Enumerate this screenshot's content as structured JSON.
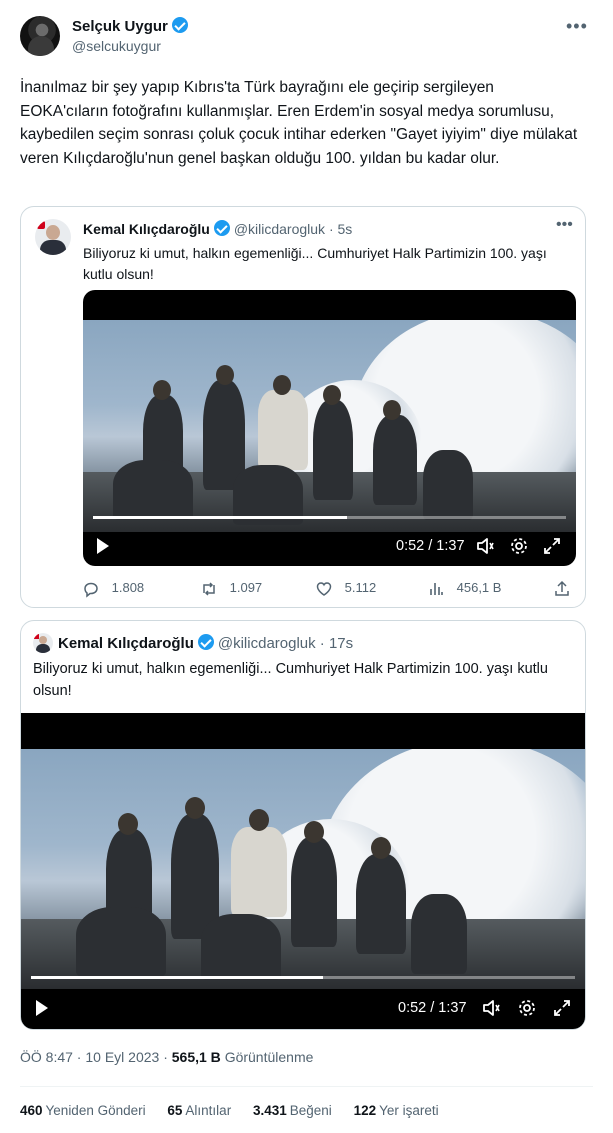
{
  "author": {
    "name": "Selçuk Uygur",
    "handle": "@selcukuygur"
  },
  "tweet_text": "İnanılmaz bir şey yapıp Kıbrıs'ta Türk bayrağını ele geçirip sergileyen EOKA'cıların fotoğrafını kullanmışlar. Eren Erdem'in sosyal medya sorumlusu, kaybedilen seçim sonrası çoluk çocuk intihar ederken \"Gayet iyiyim\" diye mülakat veren Kılıçdaroğlu'nun genel başkan olduğu 100. yıldan bu kadar olur.",
  "quoted1": {
    "name": "Kemal Kılıçdaroğlu",
    "meta": "@kilicdarogluk · 5s",
    "text": "Biliyoruz ki umut, halkın egemenliği... Cumhuriyet Halk Partimizin 100. yaşı kutlu olsun!",
    "video": {
      "time": "0:52 / 1:37",
      "progress": 0.536
    },
    "actions": {
      "replies": "1.808",
      "reposts": "1.097",
      "likes": "5.112",
      "views": "456,1 B"
    }
  },
  "quoted2": {
    "name": "Kemal Kılıçdaroğlu",
    "meta": "@kilicdarogluk · 17s",
    "text": "Biliyoruz ki umut, halkın egemenliği... Cumhuriyet Halk Partimizin 100. yaşı kutlu olsun!",
    "video": {
      "time": "0:52 / 1:37",
      "progress": 0.536
    }
  },
  "timestamp": "ÖÖ 8:47 · 10 Eyl 2023 · ",
  "views_count": "565,1 B",
  "views_label": "Görüntülenme",
  "stats": {
    "reposts_count": "460",
    "reposts_label": "Yeniden Gönderi",
    "quotes_count": "65",
    "quotes_label": "Alıntılar",
    "likes_count": "3.431",
    "likes_label": "Beğeni",
    "bookmarks_count": "122",
    "bookmarks_label": "Yer işareti"
  },
  "colors": {
    "verified": "#1d9bf0",
    "secondary_text": "#536471",
    "border": "#cfd9de"
  }
}
